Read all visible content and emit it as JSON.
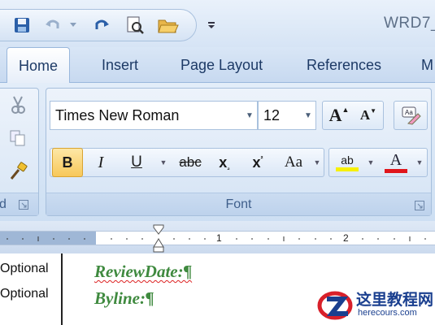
{
  "window": {
    "title": "WRD7_"
  },
  "quick_access": {
    "icons": [
      "save-icon",
      "undo-icon",
      "undo-dropdown-icon",
      "redo-icon",
      "print-preview-icon",
      "open-folder-icon",
      "customize-dropdown-icon"
    ]
  },
  "tabs": [
    {
      "label": "Home",
      "active": true
    },
    {
      "label": "Insert"
    },
    {
      "label": "Page Layout"
    },
    {
      "label": "References"
    },
    {
      "label": "M"
    }
  ],
  "font_group": {
    "label": "Font",
    "font_name": "Times New Roman",
    "font_size": "12",
    "grow_font": "A",
    "shrink_font": "A",
    "bold": "B",
    "italic": "I",
    "underline": "U",
    "strikethrough": "abc",
    "subscript": "x",
    "superscript": "x",
    "change_case": "Aa",
    "highlight": "ab",
    "font_color": "A",
    "highlight_color": "#f7f000",
    "font_color_value": "#e0151b"
  },
  "clipboard_group": {
    "label": "d"
  },
  "ruler": {
    "marks": [
      "1",
      "2"
    ]
  },
  "document": {
    "lines": [
      {
        "style": "Optional",
        "text": "ReviewDate:¶"
      },
      {
        "style": "Optional",
        "text": "Byline:¶"
      }
    ]
  },
  "watermark": {
    "title": "这里教程网",
    "url": "herecours.com"
  }
}
